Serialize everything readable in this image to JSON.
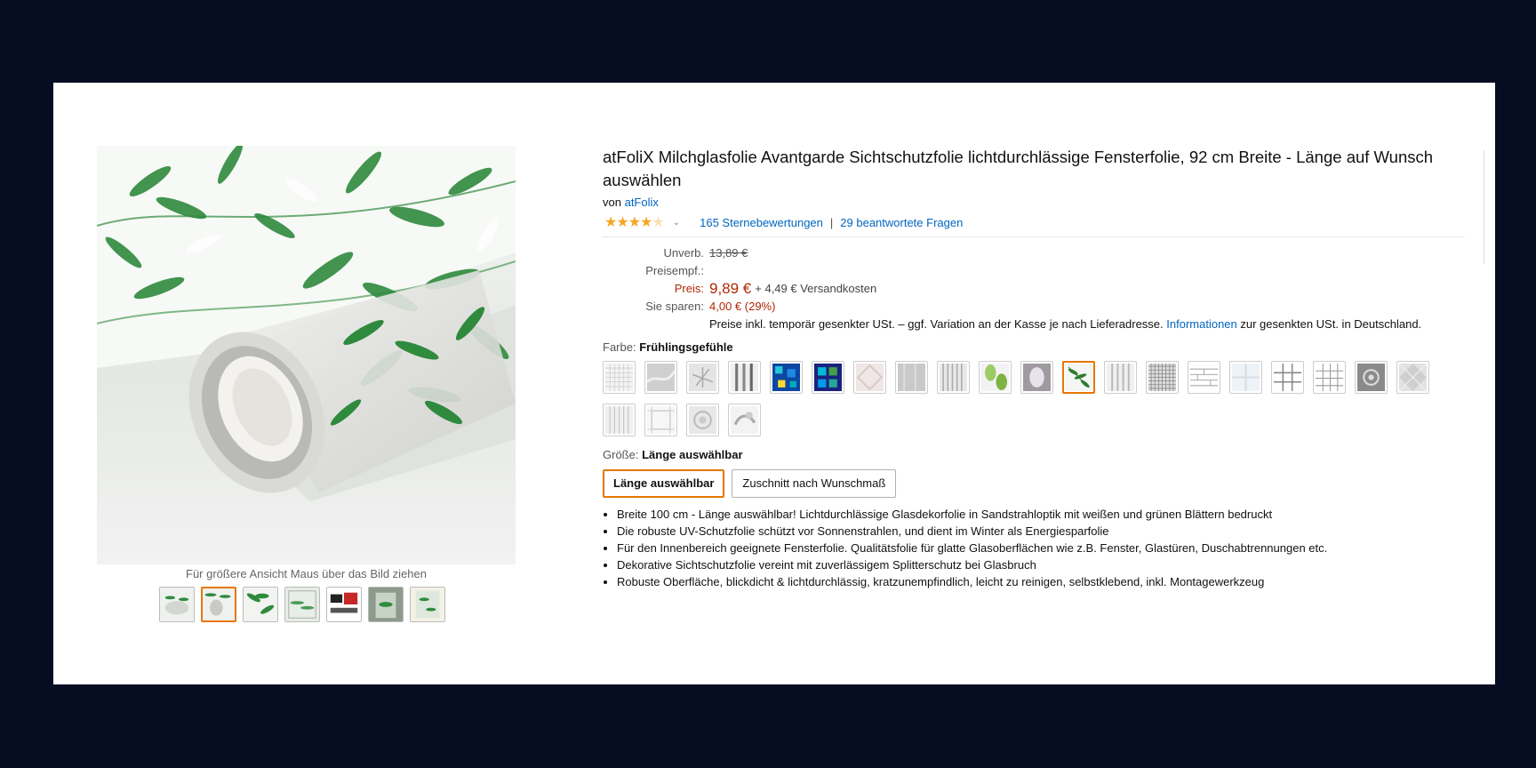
{
  "product": {
    "title": "atFoliX Milchglasfolie Avantgarde Sichtschutzfolie lichtdurchlässige Fensterfolie, 92 cm Breite - Länge auf Wunsch auswählen",
    "by_prefix": "von",
    "brand": "atFolix",
    "rating_stars": 4,
    "ratings_count": "165 Sternebewertungen",
    "answered_questions": "29 beantwortete Fragen",
    "separator": "|"
  },
  "pricing": {
    "list_label": "Unverb. Preisempf.:",
    "list_price": "13,89 €",
    "price_label": "Preis:",
    "price": "9,89 €",
    "shipping": "+ 4,49 € Versandkosten",
    "savings_label": "Sie sparen:",
    "savings": "4,00 € (29%)",
    "vat_note_prefix": "Preise inkl. temporär gesenkter USt. – ggf. Variation an der Kasse je nach Lieferadresse.",
    "vat_link": "Informationen",
    "vat_note_suffix": "zur gesenkten USt. in Deutschland."
  },
  "color": {
    "label": "Farbe:",
    "selected": "Frühlingsgefühle",
    "swatch_count": 24,
    "selected_index": 11
  },
  "size": {
    "label": "Größe:",
    "selected": "Länge auswählbar",
    "options": [
      "Länge auswählbar",
      "Zuschnitt nach Wunschmaß"
    ]
  },
  "bullets": [
    "Breite 100 cm - Länge auswählbar! Lichtdurchlässige Glasdekorfolie in Sandstrahloptik mit weißen und grünen Blättern bedruckt",
    "Die robuste UV-Schutzfolie schützt vor Sonnenstrahlen, und dient im Winter als Energiesparfolie",
    "Für den Innenbereich geeignete Fensterfolie. Qualitätsfolie für glatte Glasoberflächen wie z.B. Fenster, Glastüren, Duschabtrennungen etc.",
    "Dekorative Sichtschutzfolie vereint mit zuverlässigem Splitterschutz bei Glasbruch",
    "Robuste Oberfläche, blickdicht & lichtdurchlässig, kratzunempfindlich, leicht zu reinigen, selbstklebend, inkl. Montagewerkzeug"
  ],
  "gallery": {
    "hover_hint": "Für größere Ansicht Maus über das Bild ziehen",
    "thumb_count": 7,
    "selected_index": 1
  },
  "colors": {
    "link": "#0066c0",
    "price": "#b12704",
    "selected_border": "#e77600",
    "star": "#f5a623",
    "backdrop": "#060d22"
  }
}
